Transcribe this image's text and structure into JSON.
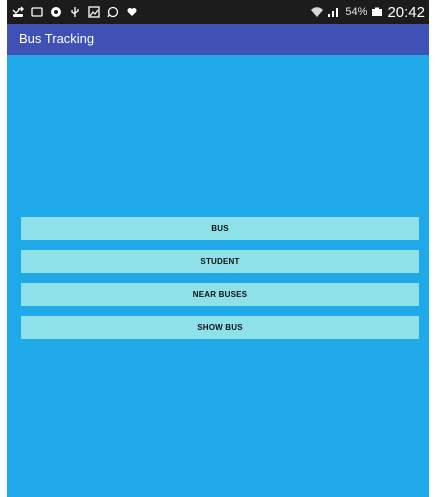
{
  "status_bar": {
    "battery_percent": "54%",
    "time": "20:42",
    "icons": [
      "missed-call-icon",
      "cast-icon",
      "chrome-icon",
      "usb-icon",
      "image-icon",
      "whatsapp-icon",
      "heart-icon",
      "wifi-icon",
      "signal-icon",
      "battery-icon"
    ]
  },
  "app_bar": {
    "title": "Bus Tracking"
  },
  "menu": {
    "buttons": [
      {
        "label": "BUS"
      },
      {
        "label": "STUDENT"
      },
      {
        "label": "NEAR BUSES"
      },
      {
        "label": "SHOW BUS"
      }
    ]
  },
  "colors": {
    "status_bar": "#1c1c1c",
    "app_bar": "#3f51b5",
    "background": "#1fa9e9",
    "button": "#8ee1e8"
  }
}
